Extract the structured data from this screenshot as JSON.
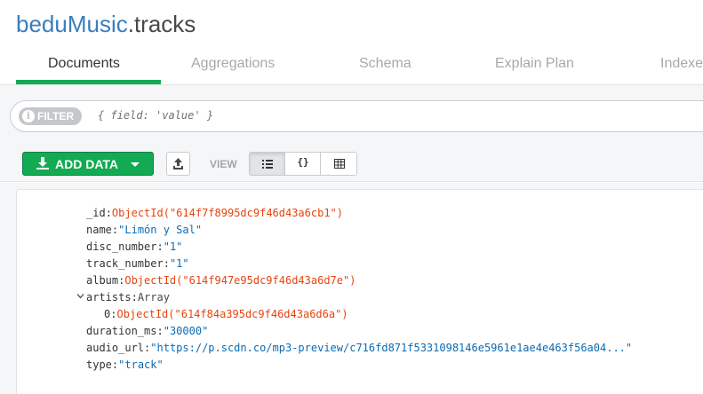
{
  "namespace": {
    "database": "beduMusic",
    "collection": ".tracks"
  },
  "tabs": [
    "Documents",
    "Aggregations",
    "Schema",
    "Explain Plan",
    "Indexe"
  ],
  "filter": {
    "label": "FILTER",
    "info": "i",
    "placeholder": "{ field: 'value' }"
  },
  "toolbar": {
    "add_data_label": "ADD DATA",
    "view_label": "VIEW",
    "json_glyph": "{}"
  },
  "icons": [
    "download-icon",
    "chevron-down-icon",
    "upload-icon",
    "list-view-icon",
    "json-view-icon",
    "table-view-icon",
    "expand-caret-icon"
  ],
  "colors": {
    "accent": "#13aa52",
    "db_name": "#3a7ebf",
    "objectid": "#e6440f",
    "string": "#0b6bb4"
  },
  "document": {
    "fields": [
      {
        "key": "_id",
        "value": "ObjectId(\"614f7f8995dc9f46d43a6cb1\")",
        "type": "objectid"
      },
      {
        "key": "name",
        "value": "\"Limón y Sal\"",
        "type": "string"
      },
      {
        "key": "disc_number",
        "value": "\"1\"",
        "type": "string"
      },
      {
        "key": "track_number",
        "value": "\"1\"",
        "type": "string"
      },
      {
        "key": "album",
        "value": "ObjectId(\"614f947e95dc9f46d43a6d7e\")",
        "type": "objectid"
      },
      {
        "key": "artists",
        "value": "Array",
        "type": "array"
      },
      {
        "key": "0",
        "value": "ObjectId(\"614f84a395dc9f46d43a6d6a\")",
        "type": "objectid"
      },
      {
        "key": "duration_ms",
        "value": "\"30000\"",
        "type": "string"
      },
      {
        "key": "audio_url",
        "value": "\"https://p.scdn.co/mp3-preview/c716fd871f5331098146e5961e1ae4e463f56a04...\"",
        "type": "string"
      },
      {
        "key": "type",
        "value": "\"track\"",
        "type": "string"
      }
    ]
  }
}
